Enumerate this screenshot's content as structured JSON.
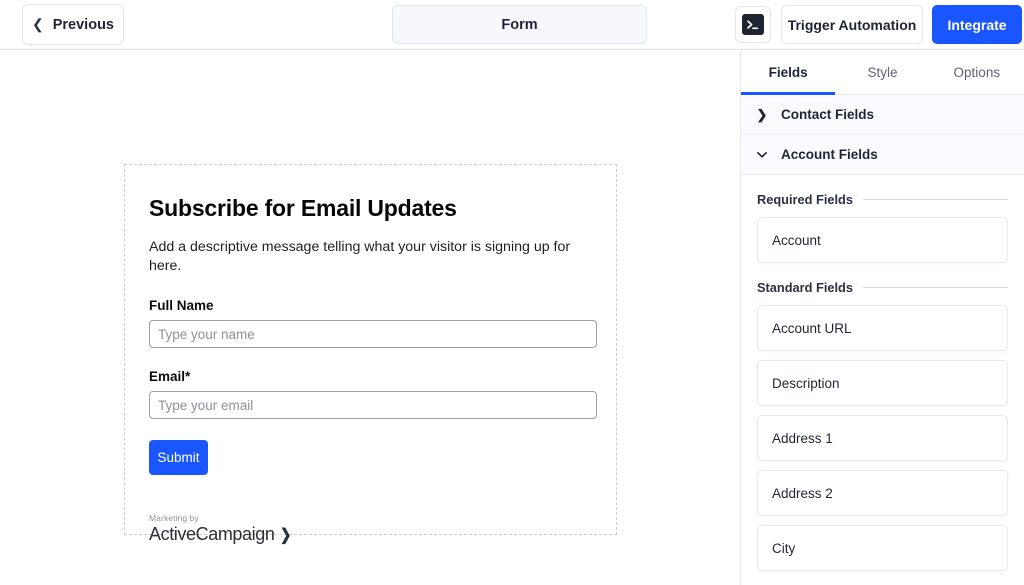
{
  "topbar": {
    "previous_label": "Previous",
    "previous_icon": "chevron-left-icon",
    "form_tab_label": "Form",
    "terminal_icon": "terminal-prompt-icon",
    "trigger_automation_label": "Trigger Automation",
    "integrate_label": "Integrate",
    "accent_color": "#1a56ff"
  },
  "form": {
    "title": "Subscribe for Email Updates",
    "description": "Add a descriptive message telling what your visitor is signing up for here.",
    "fields": [
      {
        "label": "Full Name",
        "placeholder": "Type your name",
        "value": ""
      },
      {
        "label": "Email*",
        "placeholder": "Type your email",
        "value": ""
      }
    ],
    "submit_label": "Submit",
    "branding": {
      "prefix": "Marketing by",
      "name": "ActiveCampaign",
      "mark": "❯"
    }
  },
  "sidebar": {
    "tabs": [
      {
        "label": "Fields",
        "active": true
      },
      {
        "label": "Style",
        "active": false
      },
      {
        "label": "Options",
        "active": false
      }
    ],
    "accordions": [
      {
        "label": "Contact Fields",
        "expanded": false,
        "icon": "chevron-right-icon",
        "glyph": "❯"
      },
      {
        "label": "Account Fields",
        "expanded": true,
        "icon": "chevron-down-icon",
        "glyph": "⌄"
      }
    ],
    "sections": [
      {
        "title": "Required Fields",
        "items": [
          {
            "label": "Account"
          }
        ]
      },
      {
        "title": "Standard Fields",
        "items": [
          {
            "label": "Account URL"
          },
          {
            "label": "Description"
          },
          {
            "label": "Address 1"
          },
          {
            "label": "Address 2"
          },
          {
            "label": "City"
          }
        ]
      }
    ]
  }
}
